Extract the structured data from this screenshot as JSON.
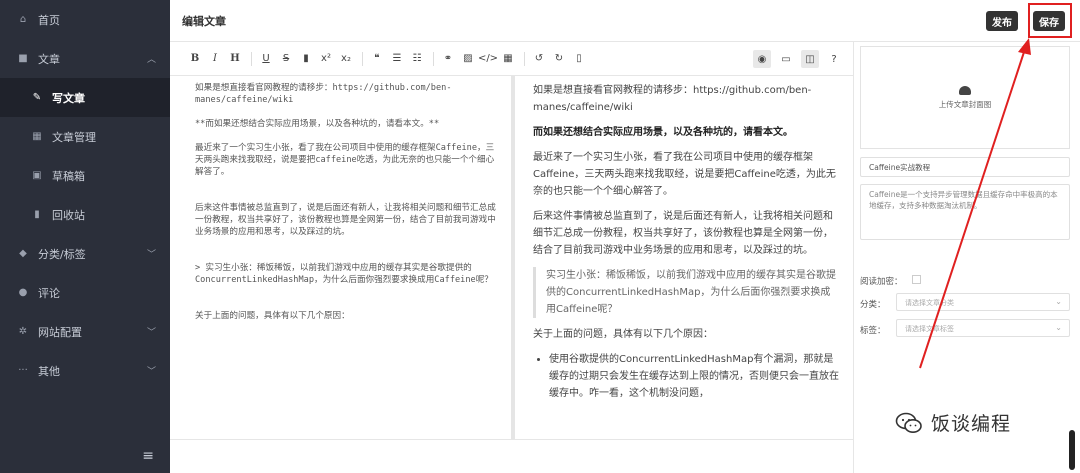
{
  "sidebar": {
    "items": [
      {
        "icon": "home-icon",
        "glyph": "⌂",
        "label": "首页"
      },
      {
        "icon": "article-icon",
        "glyph": "■",
        "label": "文章",
        "chevron": "︿"
      },
      {
        "icon": "write-icon",
        "glyph": "✎",
        "label": "写文章"
      },
      {
        "icon": "manage-icon",
        "glyph": "▦",
        "label": "文章管理"
      },
      {
        "icon": "draft-icon",
        "glyph": "▣",
        "label": "草稿箱"
      },
      {
        "icon": "trash-icon",
        "glyph": "▮",
        "label": "回收站"
      },
      {
        "icon": "tag-icon",
        "glyph": "◆",
        "label": "分类/标签",
        "chevron": "﹀"
      },
      {
        "icon": "comment-icon",
        "glyph": "●",
        "label": "评论"
      },
      {
        "icon": "settings-icon",
        "glyph": "✲",
        "label": "网站配置",
        "chevron": "﹀"
      },
      {
        "icon": "more-icon",
        "glyph": "···",
        "label": "其他",
        "chevron": "﹀"
      }
    ],
    "footer_glyph": "≡"
  },
  "header": {
    "title": "编辑文章",
    "publish_label": "发布",
    "save_label": "保存"
  },
  "editor": {
    "source": [
      "如果是想直接看官网教程的请移步：https://github.com/ben-manes/caffeine/wiki",
      "**而如果还想结合实际应用场景，以及各种坑的，请看本文。**",
      "最近来了一个实习生小张，看了我在公司项目中使用的缓存框架Caffeine，三天两头跑来找我取经，说是要把caffeine吃透，为此无奈的也只能一个个细心解答了。",
      "后来这件事情被总监直到了，说是后面还有新人，让我将相关问题和细节汇总成一份教程，权当共享好了，该份教程也算是全网第一份，结合了目前我司游戏中业务场景的应用和思考，以及踩过的坑。",
      "> 实习生小张：稀饭稀饭，以前我们游戏中应用的缓存其实是谷歌提供的ConcurrentLinkedHashMap，为什么后面你强烈要求换成用Caffeine呢？",
      "关于上面的问题，具体有以下几个原因："
    ],
    "preview": {
      "p1": "如果是想直接看官网教程的请移步：https://github.com/ben-manes/caffeine/wiki",
      "p2": "而如果还想结合实际应用场景，以及各种坑的，请看本文。",
      "p3": "最近来了一个实习生小张，看了我在公司项目中使用的缓存框架Caffeine，三天两头跑来找我取经，说是要把Caffeine吃透，为此无奈的也只能一个个细心解答了。",
      "p4": "后来这件事情被总监直到了，说是后面还有新人，让我将相关问题和细节汇总成一份教程，权当共享好了，该份教程也算是全网第一份，结合了目前我司游戏中业务场景的应用和思考，以及踩过的坑。",
      "quote": "实习生小张：稀饭稀饭，以前我们游戏中应用的缓存其实是谷歌提供的ConcurrentLinkedHashMap，为什么后面你强烈要求换成用Caffeine呢？",
      "p5": "关于上面的问题，具体有以下几个原因：",
      "li1": "使用谷歌提供的ConcurrentLinkedHashMap有个漏洞，那就是缓存的过期只会发生在缓存达到上限的情况，否则便只会一直放在缓存中。咋一看，这个机制没问题，"
    }
  },
  "toolbar": {
    "left": [
      {
        "name": "bold-button",
        "g": "B",
        "c": "b"
      },
      {
        "name": "italic-button",
        "g": "I",
        "c": "i"
      },
      {
        "name": "heading-button",
        "g": "H",
        "c": "h"
      },
      {
        "sep": true
      },
      {
        "name": "underline-button",
        "g": "U",
        "c": "u"
      },
      {
        "name": "strikethrough-button",
        "g": "S",
        "c": "s"
      },
      {
        "name": "bookmark-button",
        "g": "▮",
        "c": ""
      },
      {
        "name": "superscript-button",
        "g": "x²",
        "c": ""
      },
      {
        "name": "subscript-button",
        "g": "x₂",
        "c": ""
      },
      {
        "sep": true
      },
      {
        "name": "quote-button",
        "g": "❝",
        "c": ""
      },
      {
        "name": "ordered-list-button",
        "g": "☰",
        "c": ""
      },
      {
        "name": "unordered-list-button",
        "g": "☷",
        "c": ""
      },
      {
        "sep": true
      },
      {
        "name": "link-button",
        "g": "⚭",
        "c": ""
      },
      {
        "name": "image-button",
        "g": "▨",
        "c": ""
      },
      {
        "name": "code-button",
        "g": "</>",
        "c": ""
      },
      {
        "name": "table-button",
        "g": "▦",
        "c": ""
      },
      {
        "sep": true
      },
      {
        "name": "undo-button",
        "g": "↺",
        "c": ""
      },
      {
        "name": "redo-button",
        "g": "↻",
        "c": ""
      },
      {
        "name": "clear-button",
        "g": "▯",
        "c": ""
      }
    ],
    "right": [
      {
        "name": "preview-toggle-button",
        "g": "◉",
        "on": true
      },
      {
        "name": "fullscreen-button",
        "g": "▭",
        "on": false
      },
      {
        "name": "split-view-button",
        "g": "◫",
        "on": true
      },
      {
        "name": "help-button",
        "g": "?",
        "on": false
      }
    ]
  },
  "panel": {
    "cover_label": "上传文章封面图",
    "title_value": "Caffeine实战教程",
    "desc_value": "Caffeine是一个支持异步管理数据且缓存命中率极高的本地缓存，支持多种数据淘汰机制。",
    "encrypt_label": "阅读加密：",
    "category_label": "分类：",
    "category_placeholder": "请选择文章分类",
    "tag_label": "标签：",
    "tag_placeholder": "请选择文章标签"
  },
  "watermark": {
    "text": "饭谈编程"
  },
  "colors": {
    "sidebar_bg": "#2b2f3a",
    "accent_red": "#e02020",
    "button_dark": "#333333"
  }
}
